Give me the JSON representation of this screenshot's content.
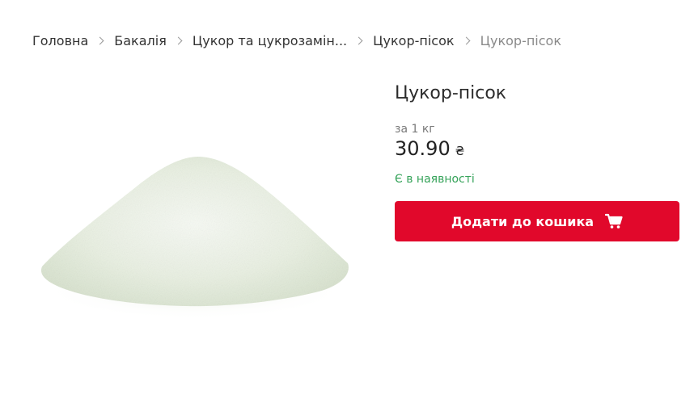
{
  "breadcrumb": {
    "items": [
      "Головна",
      "Бакалія",
      "Цукор та цукрозамін...",
      "Цукор-пісок"
    ],
    "current": "Цукор-пісок"
  },
  "product": {
    "title": "Цукор-пісок",
    "unit": "за 1 кг",
    "price": "30.90",
    "currency": "₴",
    "availability": "Є в наявності",
    "add_to_cart_label": "Додати до кошика"
  },
  "colors": {
    "accent": "#e1082b",
    "in_stock": "#36a35a"
  },
  "icons": [
    "chevron-right-icon",
    "cart-icon"
  ]
}
